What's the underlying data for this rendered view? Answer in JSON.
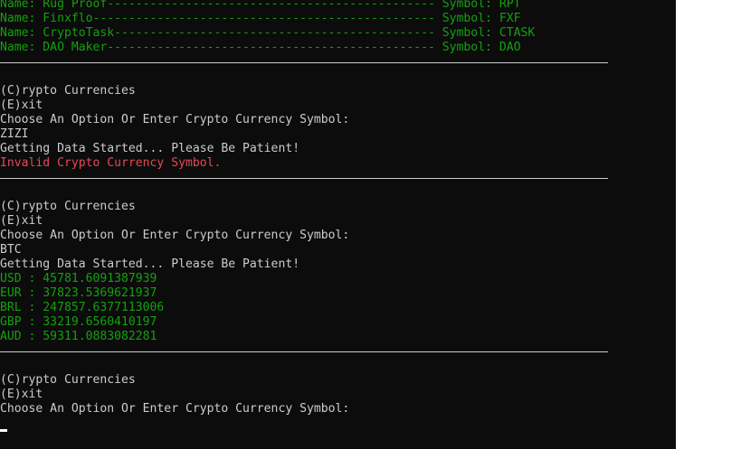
{
  "console": {
    "lines": [
      {
        "text": "Name: Rug Proof---------------------------------------------- Symbol: RPT",
        "color": "#13a10e"
      },
      {
        "text": "Name: Finxflo------------------------------------------------ Symbol: FXF",
        "color": "#13a10e"
      },
      {
        "text": "Name: CryptoTask--------------------------------------------- Symbol: CTASK",
        "color": "#13a10e"
      },
      {
        "text": "Name: DAO Maker---------------------------------------------- Symbol: DAO",
        "color": "#13a10e"
      },
      {
        "text": "",
        "separator": true
      },
      {
        "text": "",
        "color": "#cccccc"
      },
      {
        "text": "(C)rypto Currencies",
        "color": "#cccccc"
      },
      {
        "text": "(E)xit",
        "color": "#cccccc"
      },
      {
        "text": "Choose An Option Or Enter Crypto Currency Symbol:",
        "color": "#cccccc"
      },
      {
        "text": "ZIZI",
        "color": "#cccccc"
      },
      {
        "text": "Getting Data Started... Please Be Patient!",
        "color": "#cccccc"
      },
      {
        "text": "Invalid Crypto Currency Symbol.",
        "color": "#e74856"
      },
      {
        "text": "",
        "separator": true
      },
      {
        "text": "",
        "color": "#cccccc"
      },
      {
        "text": "(C)rypto Currencies",
        "color": "#cccccc"
      },
      {
        "text": "(E)xit",
        "color": "#cccccc"
      },
      {
        "text": "Choose An Option Or Enter Crypto Currency Symbol:",
        "color": "#cccccc"
      },
      {
        "text": "BTC",
        "color": "#cccccc"
      },
      {
        "text": "Getting Data Started... Please Be Patient!",
        "color": "#cccccc"
      },
      {
        "text": "USD : 45781.6091387939",
        "color": "#13a10e"
      },
      {
        "text": "EUR : 37823.5369621937",
        "color": "#13a10e"
      },
      {
        "text": "BRL : 247857.6377113006",
        "color": "#13a10e"
      },
      {
        "text": "GBP : 33219.6560410197",
        "color": "#13a10e"
      },
      {
        "text": "AUD : 59311.0883082281",
        "color": "#13a10e"
      },
      {
        "text": "",
        "separator": true
      },
      {
        "text": "",
        "color": "#cccccc"
      },
      {
        "text": "(C)rypto Currencies",
        "color": "#cccccc"
      },
      {
        "text": "(E)xit",
        "color": "#cccccc"
      },
      {
        "text": "Choose An Option Or Enter Crypto Currency Symbol:",
        "color": "#cccccc"
      }
    ]
  },
  "colors": {
    "background": "#0c0c0c",
    "text": "#cccccc",
    "success": "#13a10e",
    "error": "#e74856",
    "cursor": "#ffffff"
  }
}
